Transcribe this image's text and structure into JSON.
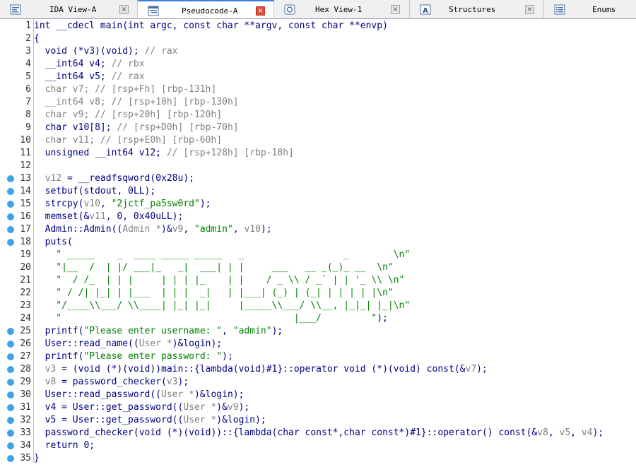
{
  "tabs": [
    {
      "label": "IDA View-A",
      "icon": "ida-view-icon",
      "close": "×",
      "active": false
    },
    {
      "label": "Pseudocode-A",
      "icon": "pseudocode-icon",
      "close": "×",
      "active": true
    },
    {
      "label": "Hex View-1",
      "icon": "hex-view-icon",
      "close": "×",
      "active": false
    },
    {
      "label": "Structures",
      "icon": "structures-icon",
      "close": "×",
      "active": false
    },
    {
      "label": "Enums",
      "icon": "enums-icon",
      "close": "",
      "active": false
    }
  ],
  "colors": {
    "keyword_blue": "#000080",
    "variable_gray": "#7f7f7f",
    "string_green": "#008000",
    "comment_gray": "#808080",
    "breakpoint_dot": "#3ba3e6",
    "active_close": "#e04a3a"
  },
  "code": {
    "lines": [
      {
        "num": "1",
        "bp": false,
        "segs": [
          [
            "b",
            "int __cdecl main(int argc, const char **argv, const char **envp)"
          ]
        ]
      },
      {
        "num": "2",
        "bp": false,
        "segs": [
          [
            "b",
            "{"
          ]
        ]
      },
      {
        "num": "3",
        "bp": false,
        "segs": [
          [
            "b",
            "  void (*v3)(void); "
          ],
          [
            "c",
            "// rax"
          ]
        ]
      },
      {
        "num": "4",
        "bp": false,
        "segs": [
          [
            "b",
            "  __int64 v4; "
          ],
          [
            "c",
            "// rbx"
          ]
        ]
      },
      {
        "num": "5",
        "bp": false,
        "segs": [
          [
            "b",
            "  __int64 v5; "
          ],
          [
            "c",
            "// rax"
          ]
        ]
      },
      {
        "num": "6",
        "bp": false,
        "segs": [
          [
            "g",
            "  char v7; "
          ],
          [
            "c",
            "// [rsp+Fh] [rbp-131h]"
          ]
        ]
      },
      {
        "num": "7",
        "bp": false,
        "segs": [
          [
            "g",
            "  __int64 v8; "
          ],
          [
            "c",
            "// [rsp+10h] [rbp-130h]"
          ]
        ]
      },
      {
        "num": "8",
        "bp": false,
        "segs": [
          [
            "g",
            "  char v9; "
          ],
          [
            "c",
            "// [rsp+20h] [rbp-120h]"
          ]
        ]
      },
      {
        "num": "9",
        "bp": false,
        "segs": [
          [
            "b",
            "  char v10[8]; "
          ],
          [
            "c",
            "// [rsp+D0h] [rbp-70h]"
          ]
        ]
      },
      {
        "num": "10",
        "bp": false,
        "segs": [
          [
            "g",
            "  char v11; "
          ],
          [
            "c",
            "// [rsp+E0h] [rbp-60h]"
          ]
        ]
      },
      {
        "num": "11",
        "bp": false,
        "segs": [
          [
            "b",
            "  unsigned __int64 v12; "
          ],
          [
            "c",
            "// [rsp+128h] [rbp-18h]"
          ]
        ]
      },
      {
        "num": "12",
        "bp": false,
        "segs": [
          [
            "b",
            ""
          ]
        ]
      },
      {
        "num": "13",
        "bp": true,
        "segs": [
          [
            "g",
            "  v12"
          ],
          [
            "b",
            " = __readfsqword(0x28u);"
          ]
        ]
      },
      {
        "num": "14",
        "bp": true,
        "segs": [
          [
            "b",
            "  setbuf(stdout, 0LL);"
          ]
        ]
      },
      {
        "num": "15",
        "bp": true,
        "segs": [
          [
            "b",
            "  strcpy("
          ],
          [
            "g",
            "v10"
          ],
          [
            "b",
            ", "
          ],
          [
            "s",
            "\"2jctf_pa5sw0rd\""
          ],
          [
            "b",
            ");"
          ]
        ]
      },
      {
        "num": "16",
        "bp": true,
        "segs": [
          [
            "b",
            "  memset(&"
          ],
          [
            "g",
            "v11"
          ],
          [
            "b",
            ", 0, 0x40uLL);"
          ]
        ]
      },
      {
        "num": "17",
        "bp": true,
        "segs": [
          [
            "b",
            "  Admin::Admin(("
          ],
          [
            "g",
            "Admin *"
          ],
          [
            "b",
            ")&"
          ],
          [
            "g",
            "v9"
          ],
          [
            "b",
            ", "
          ],
          [
            "s",
            "\"admin\""
          ],
          [
            "b",
            ", "
          ],
          [
            "g",
            "v10"
          ],
          [
            "b",
            ");"
          ]
        ]
      },
      {
        "num": "18",
        "bp": true,
        "segs": [
          [
            "b",
            "  puts("
          ]
        ]
      },
      {
        "num": "19",
        "bp": false,
        "segs": [
          [
            "s",
            "    \" _____    _  ____ _____ _____   _                  _        \\n\""
          ]
        ]
      },
      {
        "num": "20",
        "bp": false,
        "segs": [
          [
            "s",
            "    \"|__  /  | |/ ___|_   _|  ___| | |     ___   __ _(_)_ __  \\n\""
          ]
        ]
      },
      {
        "num": "21",
        "bp": false,
        "segs": [
          [
            "s",
            "    \"  / /_  | | |     | | | |_    | |    / _ \\\\ / _` | | '_ \\\\ \\n\""
          ]
        ]
      },
      {
        "num": "22",
        "bp": false,
        "segs": [
          [
            "s",
            "    \" / /| |_| | |___  | | |  _|   | |___| (_) | (_| | | | | |\\n\""
          ]
        ]
      },
      {
        "num": "23",
        "bp": false,
        "segs": [
          [
            "s",
            "    \"/____\\\\___/ \\\\____| |_| |_|     |_____\\\\___/ \\\\__, |_|_| |_|\\n\""
          ]
        ]
      },
      {
        "num": "24",
        "bp": false,
        "segs": [
          [
            "s",
            "    \"                                          |___/         \""
          ],
          [
            "b",
            ");"
          ]
        ]
      },
      {
        "num": "25",
        "bp": true,
        "segs": [
          [
            "b",
            "  printf("
          ],
          [
            "s",
            "\"Please enter username: \""
          ],
          [
            "b",
            ", "
          ],
          [
            "s",
            "\"admin\""
          ],
          [
            "b",
            ");"
          ]
        ]
      },
      {
        "num": "26",
        "bp": true,
        "segs": [
          [
            "b",
            "  User::read_name(("
          ],
          [
            "g",
            "User *"
          ],
          [
            "b",
            ")&login);"
          ]
        ]
      },
      {
        "num": "27",
        "bp": true,
        "segs": [
          [
            "b",
            "  printf("
          ],
          [
            "s",
            "\"Please enter password: \""
          ],
          [
            "b",
            ");"
          ]
        ]
      },
      {
        "num": "28",
        "bp": true,
        "segs": [
          [
            "g",
            "  v3"
          ],
          [
            "b",
            " = (void (*)(void))main::{lambda(void)#1}::operator void (*)(void) const(&"
          ],
          [
            "g",
            "v7"
          ],
          [
            "b",
            ");"
          ]
        ]
      },
      {
        "num": "29",
        "bp": true,
        "segs": [
          [
            "g",
            "  v8"
          ],
          [
            "b",
            " = password_checker("
          ],
          [
            "g",
            "v3"
          ],
          [
            "b",
            ");"
          ]
        ]
      },
      {
        "num": "30",
        "bp": true,
        "segs": [
          [
            "b",
            "  User::read_password(("
          ],
          [
            "g",
            "User *"
          ],
          [
            "b",
            ")&login);"
          ]
        ]
      },
      {
        "num": "31",
        "bp": true,
        "segs": [
          [
            "b",
            "  v4 = User::get_password(("
          ],
          [
            "g",
            "User *"
          ],
          [
            "b",
            ")&"
          ],
          [
            "g",
            "v9"
          ],
          [
            "b",
            ");"
          ]
        ]
      },
      {
        "num": "32",
        "bp": true,
        "segs": [
          [
            "b",
            "  v5 = User::get_password(("
          ],
          [
            "g",
            "User *"
          ],
          [
            "b",
            ")&login);"
          ]
        ]
      },
      {
        "num": "33",
        "bp": true,
        "segs": [
          [
            "b",
            "  password_checker(void (*)(void))::{lambda(char const*,char const*)#1}::operator() const(&"
          ],
          [
            "g",
            "v8"
          ],
          [
            "b",
            ", "
          ],
          [
            "g",
            "v5"
          ],
          [
            "b",
            ", "
          ],
          [
            "g",
            "v4"
          ],
          [
            "b",
            ");"
          ]
        ]
      },
      {
        "num": "34",
        "bp": true,
        "segs": [
          [
            "b",
            "  return 0;"
          ]
        ]
      },
      {
        "num": "35",
        "bp": true,
        "segs": [
          [
            "b",
            "}"
          ]
        ]
      }
    ]
  }
}
